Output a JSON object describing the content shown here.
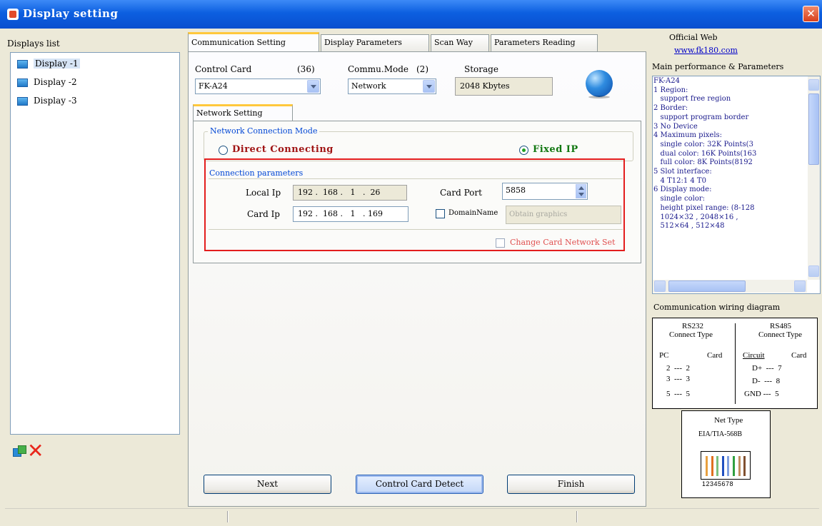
{
  "window": {
    "title": "Display setting"
  },
  "left": {
    "displays_list_label": "Displays list",
    "displays": [
      "Display -1",
      "Display -2",
      "Display -3"
    ]
  },
  "tabs": [
    "Communication Setting",
    "Display Parameters",
    "Scan Way",
    "Parameters Reading"
  ],
  "comm": {
    "control_card_label": "Control Card",
    "control_card_count": "(36)",
    "control_card_value": "FK-A24",
    "comm_mode_label": "Commu.Mode",
    "comm_mode_count": "(2)",
    "comm_mode_value": "Network",
    "storage_label": "Storage",
    "storage_value": "2048 Kbytes",
    "subtab": "Network Setting",
    "conn_mode_legend": "Network Connection Mode",
    "radio_direct": "Direct Connecting",
    "radio_fixed": "Fixed IP",
    "selected_mode": "Fixed IP",
    "conn_params_legend": "Connection parameters",
    "local_ip_label": "Local Ip",
    "local_ip": "192 .  168 .   1   .  26",
    "card_ip_label": "Card Ip",
    "card_ip": "192 .  168 .   1   . 169",
    "card_port_label": "Card Port",
    "card_port": "5858",
    "domain_label": "DomainName",
    "domain_placeholder": "Obtain graphics",
    "change_card_network": "Change Card Network Set"
  },
  "buttons": {
    "next": "Next",
    "detect": "Control Card Detect",
    "finish": "Finish"
  },
  "right": {
    "official_web_label": "Official Web",
    "official_web_link": "www.fk180.com",
    "perf_label": "Main performance & Parameters",
    "perf_lines": [
      "FK-A24",
      "1 Region:",
      "   support free region",
      "2 Border:",
      "   support program border",
      "3 No Device",
      "4 Maximum pixels:",
      "   single color: 32K Points(3",
      "   dual color: 16K Points(163",
      "   full color: 8K Points(8192",
      "5 Slot interface:",
      "   4 T12:1 4 T0",
      "6 Display mode:",
      "   single color:",
      "   height pixel range: (8-128",
      "   1024×32 , 2048×16 ,",
      "   512×64 , 512×48"
    ],
    "wiring_label": "Communication wiring diagram",
    "rs232": {
      "title": "RS232",
      "subtitle": "Connect Type",
      "col_left": "PC",
      "col_right": "Card",
      "rows": [
        "2  ---  2",
        "3  ---  3",
        "5  ---  5"
      ]
    },
    "rs485": {
      "title": "RS485",
      "subtitle": "Connect Type",
      "col_left": "Circuit",
      "col_right": "Card",
      "rows": [
        "D+  ---  7",
        "D-  ---  8",
        "GND ---  5"
      ]
    },
    "net_type_label": "Net Type",
    "net_type_std": "EIA/TIA-568B",
    "rj45_numbers": "12345678",
    "pin_colors": [
      "#e8a040",
      "#e07020",
      "#7cc07c",
      "#2050c0",
      "#80a0e0",
      "#30a040",
      "#c09060",
      "#805030"
    ]
  },
  "accent": {
    "highlight": "#e31d1d",
    "title_bar": "#0c5fe0"
  }
}
